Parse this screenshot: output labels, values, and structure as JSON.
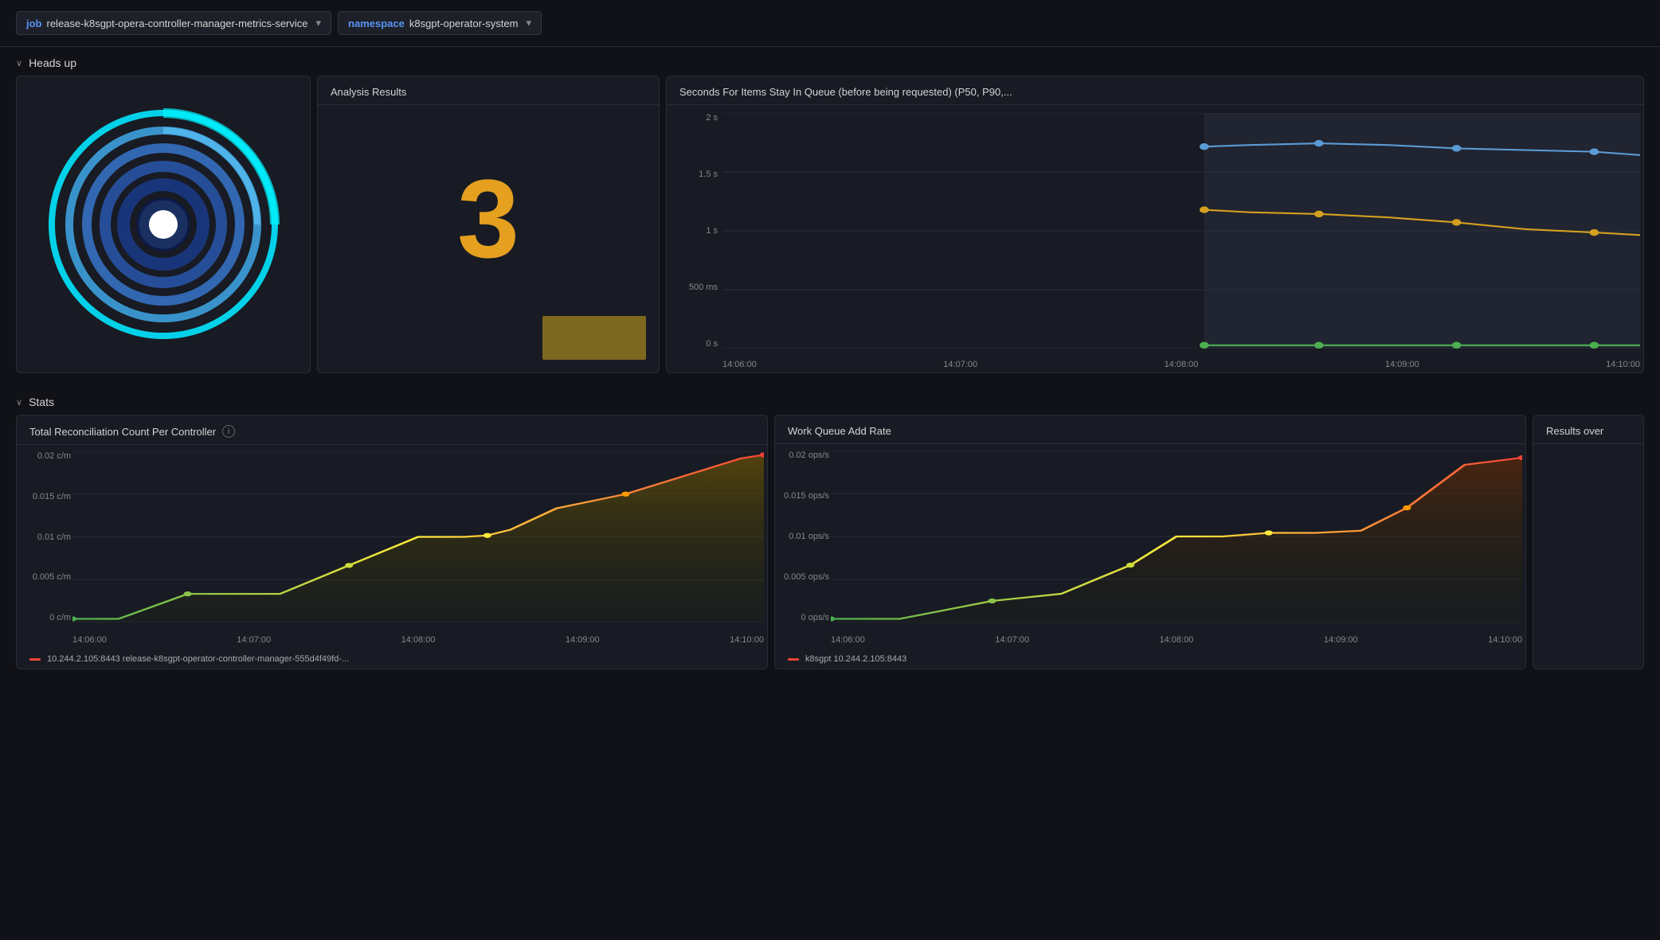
{
  "topbar": {
    "job_label": "job",
    "job_value": "release-k8sgpt-opera-controller-manager-metrics-service",
    "namespace_label": "namespace",
    "namespace_value": "k8sgpt-operator-system"
  },
  "heads_up": {
    "section_label": "Heads up",
    "analysis_panel_title": "Analysis Results",
    "analysis_number": "3",
    "queue_panel_title": "Seconds For Items Stay In Queue (before being requested) (P50, P90,...",
    "queue_y_labels": [
      "2 s",
      "1.5 s",
      "1 s",
      "500 ms",
      "0 s"
    ],
    "queue_x_labels": [
      "14:06:00",
      "14:07:00",
      "14:08:00",
      "14:09:00",
      "14:10:00"
    ]
  },
  "stats": {
    "section_label": "Stats",
    "reconciliation_title": "Total Reconciliation Count Per Controller",
    "reconciliation_y_labels": [
      "0.02 c/m",
      "0.015 c/m",
      "0.01 c/m",
      "0.005 c/m",
      "0 c/m"
    ],
    "reconciliation_x_labels": [
      "14:06:00",
      "14:07:00",
      "14:08:00",
      "14:09:00",
      "14:10:00"
    ],
    "reconciliation_legend": "10.244.2.105:8443 release-k8sgpt-operator-controller-manager-555d4f49fd-...",
    "workqueue_title": "Work Queue Add Rate",
    "workqueue_y_labels": [
      "0.02 ops/s",
      "0.015 ops/s",
      "0.01 ops/s",
      "0.005 ops/s",
      "0 ops/s"
    ],
    "workqueue_x_labels": [
      "14:06:00",
      "14:07:00",
      "14:08:00",
      "14:09:00",
      "14:10:00"
    ],
    "workqueue_legend": "k8sgpt 10.244.2.105:8443",
    "results_over_title": "Results over"
  },
  "icons": {
    "chevron_down": "▾",
    "chevron_right": "›",
    "info": "i"
  }
}
